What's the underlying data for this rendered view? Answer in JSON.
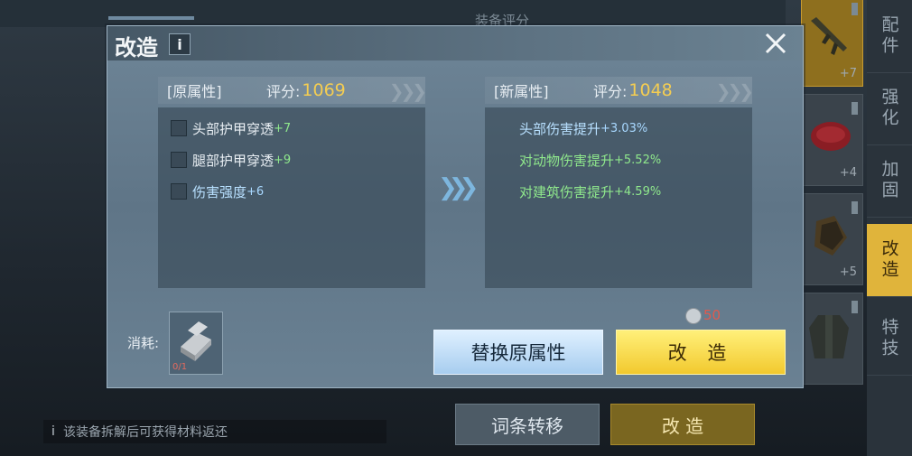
{
  "background": {
    "top_title": "装备评分",
    "side_tabs": [
      {
        "label": "配件",
        "active": false
      },
      {
        "label": "强化",
        "active": false
      },
      {
        "label": "加固",
        "active": false
      },
      {
        "label": "改造",
        "active": true
      },
      {
        "label": "特技",
        "active": false
      }
    ],
    "items": [
      {
        "name": "rifle-item",
        "plus": "+7"
      },
      {
        "name": "helmet-item",
        "plus": "+4"
      },
      {
        "name": "glove-item",
        "plus": "+5"
      },
      {
        "name": "armor-item",
        "plus": ""
      }
    ],
    "bottom_buttons": {
      "transfer": "词条转移",
      "reform": "改 造"
    },
    "hint": {
      "icon": "i",
      "text": "该装备拆解后可获得材料返还"
    }
  },
  "modal": {
    "title": "改造",
    "info_label": "i",
    "old_panel": {
      "tag": "[原属性]",
      "score_label": "评分:",
      "score": "1069",
      "attributes": [
        {
          "name": "头部护甲穿透",
          "value": "+7",
          "color": "green"
        },
        {
          "name": "腿部护甲穿透",
          "value": "+9",
          "color": "green"
        },
        {
          "name": "伤害强度",
          "value": "+6",
          "color": "blue"
        }
      ]
    },
    "new_panel": {
      "tag": "[新属性]",
      "score_label": "评分:",
      "score": "1048",
      "attributes": [
        {
          "name": "头部伤害提升",
          "value": "+3.03%",
          "color": "blue"
        },
        {
          "name": "对动物伤害提升",
          "value": "+5.52%",
          "color": "green"
        },
        {
          "name": "对建筑伤害提升",
          "value": "+4.59%",
          "color": "green"
        }
      ]
    },
    "cost": {
      "label": "消耗:",
      "material_count": "0/1",
      "coin_value": "50"
    },
    "buttons": {
      "replace": "替换原属性",
      "reform": "改 造"
    }
  }
}
